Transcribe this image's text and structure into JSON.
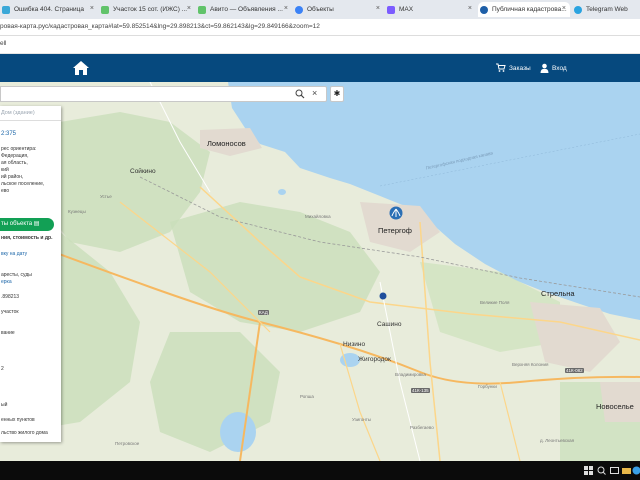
{
  "browser": {
    "tabs": [
      {
        "label": "Ошибка 404. Страница",
        "color": "#3aa8d8"
      },
      {
        "label": "Участок 15 сот. (ИЖС) ...",
        "color": "#61c36a"
      },
      {
        "label": "Авито — Объявления ...",
        "color": "#61c36a"
      },
      {
        "label": "Объекты",
        "color": "#3b82f6"
      },
      {
        "label": "MAX",
        "color": "#7c5cff"
      },
      {
        "label": "Публичная кадастрова...",
        "color": "#1e5fa8"
      },
      {
        "label": "Telegram Web",
        "color": "#2aa3e0"
      }
    ],
    "close_glyph": "×",
    "url": "ровая-карта.рус/кадастровая_карта#lat=59.852514&lng=29.898213&ct=59.862143&lg=29.849166&zoom=12",
    "bookmark": "ell"
  },
  "header": {
    "orders_label": "Заказы",
    "login_label": "Вход",
    "bg_color": "#06497e"
  },
  "search": {
    "placeholder": "",
    "clear_glyph": "×",
    "settings_glyph": "✱"
  },
  "panel": {
    "tab_label": "Дом (здание)",
    "cadastral": "2:375",
    "address_lines": [
      "рес ориентира:",
      "Федерация,",
      "ая область,",
      "кий",
      "ий район,",
      "льское поселение,",
      "ево"
    ],
    "object_button": "ты объекта",
    "object_hint": "ния, стоимость и др.",
    "date_link": "вку на дату",
    "arrests_line": "аресты, суды",
    "arrests_link": "ерка",
    "coordinate": ".898213",
    "type_line": "участок",
    "purpose_line": "вание",
    "number_line": "2",
    "status_line": "ый",
    "places_line": "енных пунктов",
    "usage_line": "льство жилого дома"
  },
  "map": {
    "places": {
      "lomonosov": "Ломоносов",
      "peterhof": "Петергоф",
      "strelna": "Стрельна",
      "novoselye": "Новоселье",
      "soikino": "Сойкино",
      "ustye": "Устье",
      "kuznecy": "Кузнецы",
      "mikhailovka": "Михайловка",
      "velikie_polya": "Великие Поля",
      "savino": "Сашино",
      "nizino": "Низино",
      "zhigorodok": "Жигородок",
      "vladimirovka": "Владимировка",
      "ropsha": "Ропша",
      "uzigonty": "Узигонты",
      "razbegaevo": "Разбегаево",
      "petrovskoe": "Петровское",
      "verhnyaya_kolonia": "Верхняя Колония",
      "gorbunki": "Горбунки",
      "leontyevskaya": "д. Леонтьевская"
    },
    "road_shields": [
      "КАД",
      "41К-135",
      "41К-082"
    ],
    "water_label": "Петергофская подходная канава",
    "water_color": "#aad3f0",
    "land_color": "#e8ecdb",
    "forest_color": "#c9dfba"
  },
  "taskbar": {
    "icons": [
      "windows-icon",
      "search-icon",
      "task-view-icon",
      "files-icon",
      "browser-icon"
    ]
  }
}
